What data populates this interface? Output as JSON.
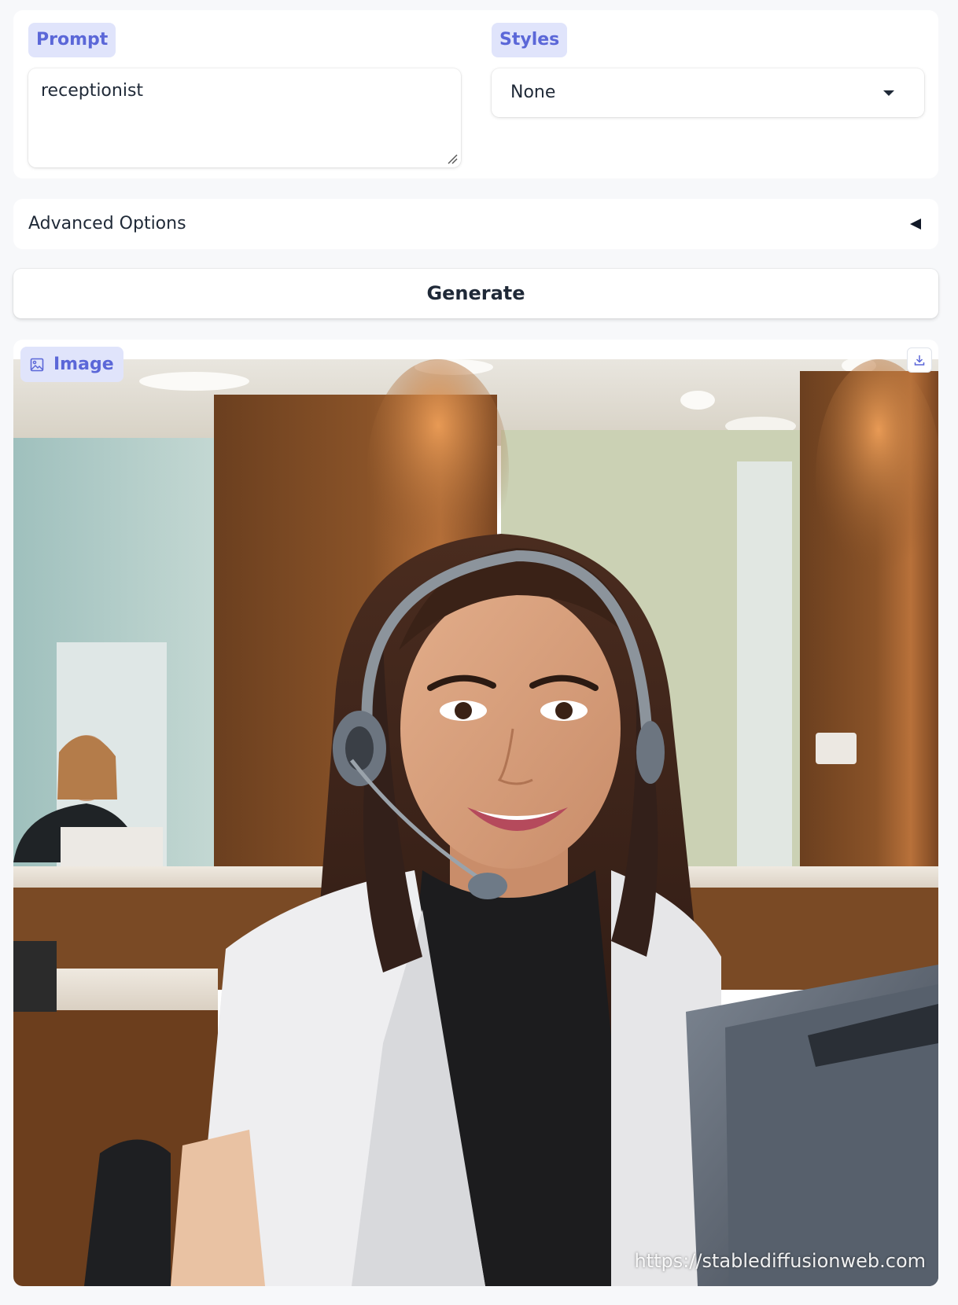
{
  "prompt": {
    "label": "Prompt",
    "value": "receptionist"
  },
  "styles": {
    "label": "Styles",
    "selected": "None"
  },
  "advanced_options": {
    "label": "Advanced Options"
  },
  "generate": {
    "label": "Generate"
  },
  "output": {
    "label": "Image",
    "watermark": "https://stablediffusionweb.com"
  },
  "colors": {
    "label_bg": "#e0e4fb",
    "label_text": "#5b67d8",
    "page_bg": "#f7f8fa"
  },
  "icons": [
    "image-icon",
    "download-icon",
    "dropdown-caret-icon",
    "collapse-arrow-icon",
    "resize-grip-icon"
  ]
}
